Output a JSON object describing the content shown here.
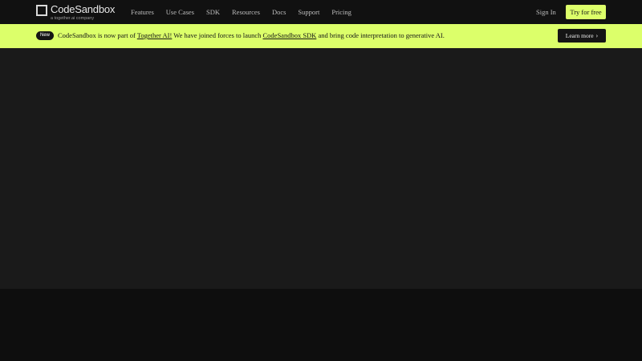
{
  "header": {
    "logo_name": "CodeSandbox",
    "logo_sub": "a together.ai company",
    "nav": [
      "Features",
      "Use Cases",
      "SDK",
      "Resources",
      "Docs",
      "Support",
      "Pricing"
    ],
    "signin_label": "Sign In",
    "cta_label": "Try for free"
  },
  "banner": {
    "badge": "New",
    "text_1": "CodeSandbox is now part of ",
    "link_1": "Together AI!",
    "text_2": " We have joined forces to launch ",
    "link_2": "CodeSandbox SDK",
    "text_3": " and bring code interpretation to generative AI.",
    "learn_more_label": "Learn more"
  },
  "colors": {
    "accent": "#dcff6a",
    "header_bg": "#111111",
    "main_bg": "#1a1a1a"
  }
}
